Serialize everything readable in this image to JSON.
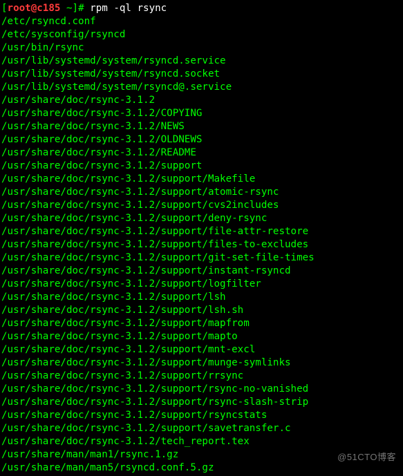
{
  "prompt": {
    "open_bracket": "[",
    "user_host": "root@c185",
    "cwd": " ~",
    "close_bracket": "]",
    "hash": "# ",
    "command": "rpm -ql rsync"
  },
  "output_lines": [
    "/etc/rsyncd.conf",
    "/etc/sysconfig/rsyncd",
    "/usr/bin/rsync",
    "/usr/lib/systemd/system/rsyncd.service",
    "/usr/lib/systemd/system/rsyncd.socket",
    "/usr/lib/systemd/system/rsyncd@.service",
    "/usr/share/doc/rsync-3.1.2",
    "/usr/share/doc/rsync-3.1.2/COPYING",
    "/usr/share/doc/rsync-3.1.2/NEWS",
    "/usr/share/doc/rsync-3.1.2/OLDNEWS",
    "/usr/share/doc/rsync-3.1.2/README",
    "/usr/share/doc/rsync-3.1.2/support",
    "/usr/share/doc/rsync-3.1.2/support/Makefile",
    "/usr/share/doc/rsync-3.1.2/support/atomic-rsync",
    "/usr/share/doc/rsync-3.1.2/support/cvs2includes",
    "/usr/share/doc/rsync-3.1.2/support/deny-rsync",
    "/usr/share/doc/rsync-3.1.2/support/file-attr-restore",
    "/usr/share/doc/rsync-3.1.2/support/files-to-excludes",
    "/usr/share/doc/rsync-3.1.2/support/git-set-file-times",
    "/usr/share/doc/rsync-3.1.2/support/instant-rsyncd",
    "/usr/share/doc/rsync-3.1.2/support/logfilter",
    "/usr/share/doc/rsync-3.1.2/support/lsh",
    "/usr/share/doc/rsync-3.1.2/support/lsh.sh",
    "/usr/share/doc/rsync-3.1.2/support/mapfrom",
    "/usr/share/doc/rsync-3.1.2/support/mapto",
    "/usr/share/doc/rsync-3.1.2/support/mnt-excl",
    "/usr/share/doc/rsync-3.1.2/support/munge-symlinks",
    "/usr/share/doc/rsync-3.1.2/support/rrsync",
    "/usr/share/doc/rsync-3.1.2/support/rsync-no-vanished",
    "/usr/share/doc/rsync-3.1.2/support/rsync-slash-strip",
    "/usr/share/doc/rsync-3.1.2/support/rsyncstats",
    "/usr/share/doc/rsync-3.1.2/support/savetransfer.c",
    "/usr/share/doc/rsync-3.1.2/tech_report.tex",
    "/usr/share/man/man1/rsync.1.gz",
    "/usr/share/man/man5/rsyncd.conf.5.gz"
  ],
  "watermark": "@51CTO博客"
}
